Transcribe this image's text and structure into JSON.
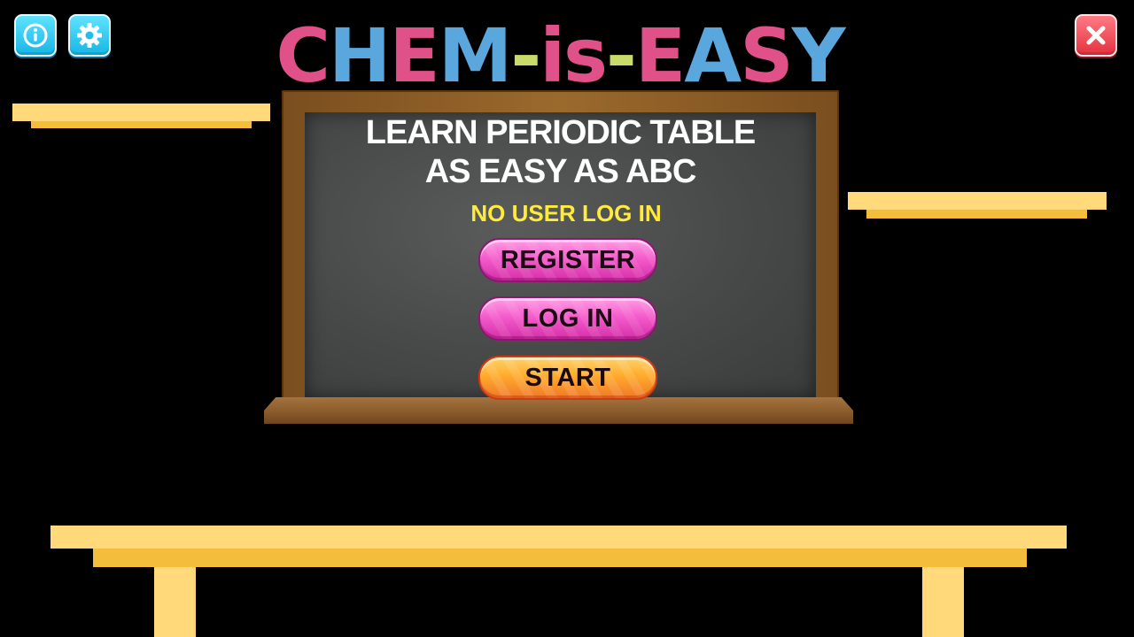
{
  "icons": {
    "info": "info-icon",
    "settings": "gear-icon",
    "close": "close-icon"
  },
  "logo": {
    "letters": [
      {
        "ch": "C",
        "color": "#e0518a"
      },
      {
        "ch": "H",
        "color": "#5aa7dd"
      },
      {
        "ch": "E",
        "color": "#e0518a"
      },
      {
        "ch": "M",
        "color": "#5aa7dd"
      },
      {
        "ch": "-",
        "color": "#c9dc6a"
      },
      {
        "ch": "i",
        "color": "#e0518a"
      },
      {
        "ch": "s",
        "color": "#e0518a"
      },
      {
        "ch": "-",
        "color": "#c9dc6a"
      },
      {
        "ch": "E",
        "color": "#e0518a"
      },
      {
        "ch": "A",
        "color": "#5aa7dd"
      },
      {
        "ch": "S",
        "color": "#e0518a"
      },
      {
        "ch": "Y",
        "color": "#5aa7dd"
      }
    ]
  },
  "board": {
    "headline_line1": "LEARN PERIODIC TABLE",
    "headline_line2": "AS EASY AS ABC",
    "status": "NO USER LOG IN"
  },
  "buttons": {
    "register": "REGISTER",
    "login": "LOG IN",
    "start": "START"
  },
  "colors": {
    "shelf": "#ffd97a",
    "shelf_shadow": "#f4bd3b",
    "status_text": "#ffeb3b"
  }
}
